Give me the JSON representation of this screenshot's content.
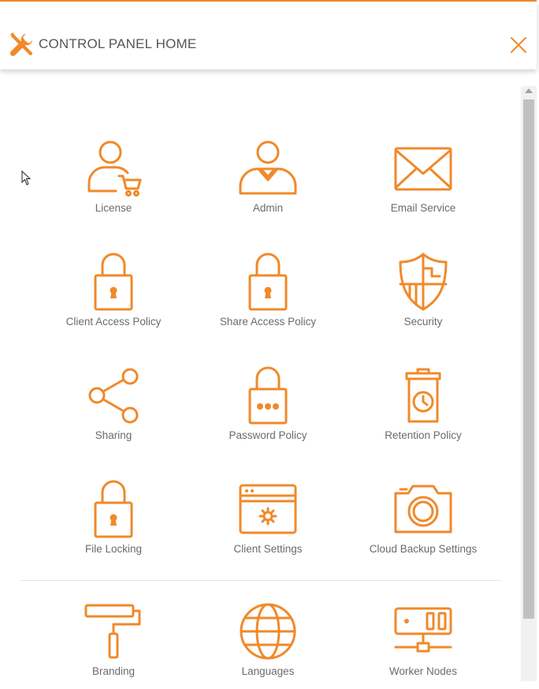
{
  "header": {
    "title": "CONTROL PANEL HOME",
    "icon": "tools-icon",
    "close_icon": "close-icon"
  },
  "colors": {
    "accent": "#f0892a",
    "label": "#6b6b6b",
    "title": "#555555"
  },
  "tiles": [
    {
      "label": "License",
      "icon": "user-cart-icon"
    },
    {
      "label": "Admin",
      "icon": "admin-user-icon"
    },
    {
      "label": "Email Service",
      "icon": "envelope-icon"
    },
    {
      "label": "Client Access Policy",
      "icon": "padlock-icon"
    },
    {
      "label": "Share Access Policy",
      "icon": "padlock-icon"
    },
    {
      "label": "Security",
      "icon": "shield-icon"
    },
    {
      "label": "Sharing",
      "icon": "share-icon"
    },
    {
      "label": "Password Policy",
      "icon": "password-lock-icon"
    },
    {
      "label": "Retention Policy",
      "icon": "trash-clock-icon"
    },
    {
      "label": "File Locking",
      "icon": "padlock-icon"
    },
    {
      "label": "Client Settings",
      "icon": "browser-gear-icon"
    },
    {
      "label": "Cloud Backup Settings",
      "icon": "camera-icon"
    },
    {
      "label": "Branding",
      "icon": "paint-roller-icon"
    },
    {
      "label": "Languages",
      "icon": "globe-icon"
    },
    {
      "label": "Worker Nodes",
      "icon": "server-icon"
    }
  ]
}
